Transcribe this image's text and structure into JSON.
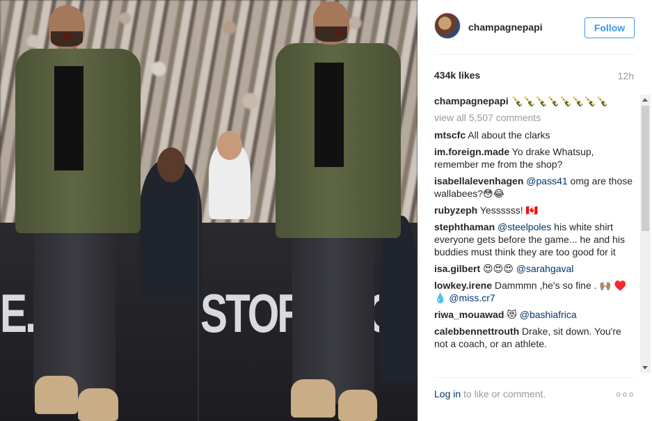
{
  "post": {
    "username": "champagnepapi",
    "follow_label": "Follow",
    "likes": "434k likes",
    "time": "12h"
  },
  "photo": {
    "board_left": "E.COI",
    "board_right": "STORE.CO"
  },
  "comments": {
    "caption": {
      "user": "champagnepapi",
      "text": " 🍾🍾🍾🍾🍾🍾🍾🍾"
    },
    "view_all": "view all 5,507 comments",
    "items": [
      {
        "user": "mtscfc",
        "text": " All about the clarks",
        "mention": "",
        "after": ""
      },
      {
        "user": "im.foreign.made",
        "text": " Yo drake Whatsup, remember me from the shop?",
        "mention": "",
        "after": ""
      },
      {
        "user": "isabellalevenhagen",
        "text": " ",
        "mention": "@pass41",
        "after": " omg are those wallabees?😳😂"
      },
      {
        "user": "rubyzeph",
        "text": " Yessssss! 🇨🇦",
        "mention": "",
        "after": ""
      },
      {
        "user": "stephthaman",
        "text": " ",
        "mention": "@steelpoles",
        "after": " his white shirt everyone gets before the game... he and his buddies must think they are too good for it"
      },
      {
        "user": "isa.gilbert",
        "text": " 😍😍😍 ",
        "mention": "@sarahgaval",
        "after": ""
      },
      {
        "user": "lowkey.irene",
        "text": " Dammmn ,he's so fine . 🙌🏽 ♥️💧 ",
        "mention": "@miss.cr7",
        "after": ""
      },
      {
        "user": "riwa_mouawad",
        "text": " 😻 ",
        "mention": "@bashiafrica",
        "after": ""
      },
      {
        "user": "calebbennettrouth",
        "text": " Drake, sit down. You're not a coach, or an athlete.",
        "mention": "",
        "after": ""
      }
    ]
  },
  "footer": {
    "login": "Log in",
    "rest": " to like or comment.",
    "more": "ooo"
  },
  "colors": {
    "link": "#003569",
    "follow": "#3897f0",
    "muted": "#999999"
  },
  "icons": [
    "more-options-icon",
    "scroll-up-arrow-icon",
    "scroll-down-arrow-icon"
  ]
}
